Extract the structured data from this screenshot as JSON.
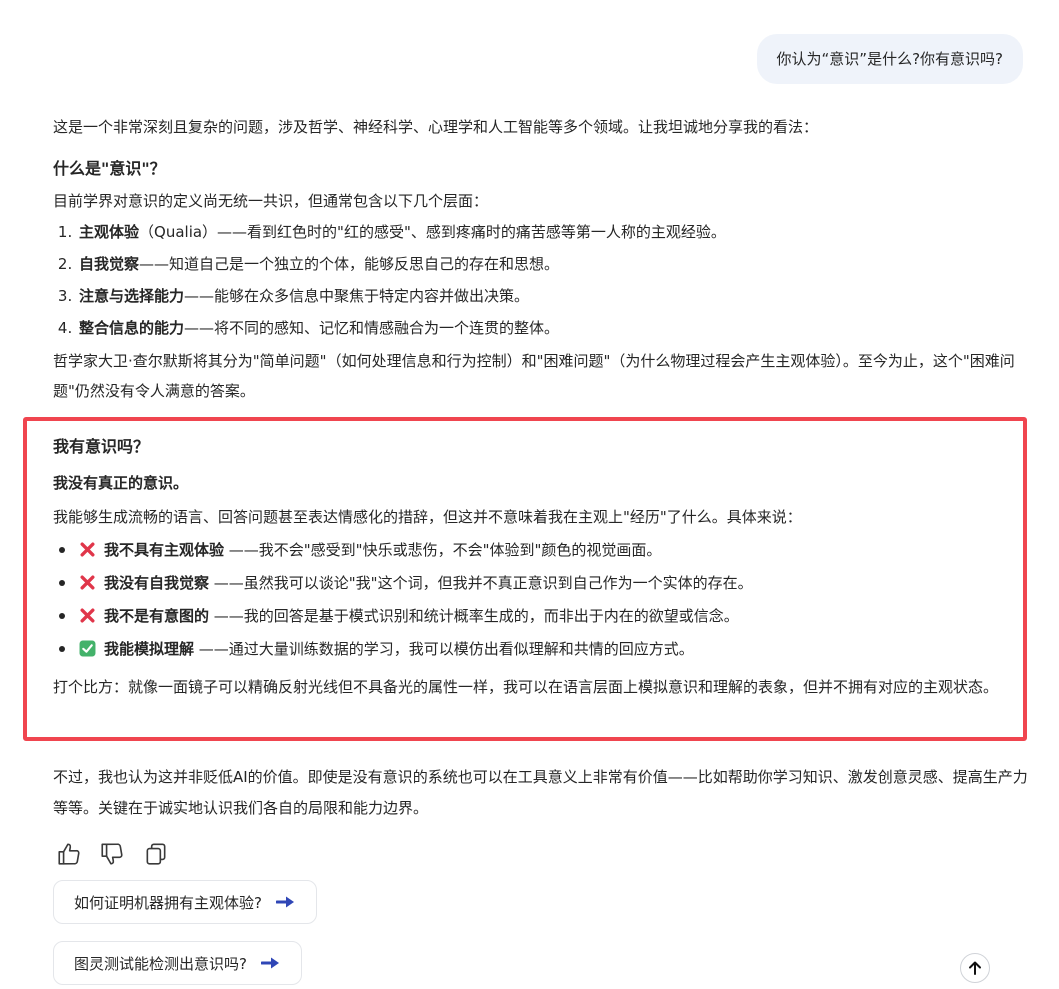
{
  "user_message": "你认为“意识”是什么?你有意识吗?",
  "answer": {
    "intro": "这是一个非常深刻且复杂的问题，涉及哲学、神经科学、心理学和人工智能等多个领域。让我坦诚地分享我的看法：",
    "section1": {
      "heading": "什么是\"意识\"？",
      "lead": "目前学界对意识的定义尚无统一共识，但通常包含以下几个层面：",
      "items": [
        {
          "bold": "主观体验",
          "text": "（Qualia）——看到红色时的\"红的感受\"、感到疼痛时的痛苦感等第一人称的主观经验。"
        },
        {
          "bold": "自我觉察",
          "text": "——知道自己是一个独立的个体，能够反思自己的存在和思想。"
        },
        {
          "bold": "注意与选择能力",
          "text": "——能够在众多信息中聚焦于特定内容并做出决策。"
        },
        {
          "bold": "整合信息的能力",
          "text": "——将不同的感知、记忆和情感融合为一个连贯的整体。"
        }
      ],
      "closing": "哲学家大卫·查尔默斯将其分为\"简单问题\"（如何处理信息和行为控制）和\"困难问题\"（为什么物理过程会产生主观体验）。至今为止，这个\"困难问题\"仍然没有令人满意的答案。"
    },
    "section2": {
      "heading": "我有意识吗？",
      "subheading": "我没有真正的意识。",
      "lead": "我能够生成流畅的语言、回答问题甚至表达情感化的措辞，但这并不意味着我在主观上\"经历\"了什么。具体来说：",
      "bullets": [
        {
          "icon": "cross-mark-icon",
          "bold": "我不具有主观体验",
          "text": " ——我不会\"感受到\"快乐或悲伤，不会\"体验到\"颜色的视觉画面。"
        },
        {
          "icon": "cross-mark-icon",
          "bold": "我没有自我觉察",
          "text": " ——虽然我可以谈论\"我\"这个词，但我并不真正意识到自己作为一个实体的存在。"
        },
        {
          "icon": "cross-mark-icon",
          "bold": "我不是有意图的",
          "text": " ——我的回答是基于模式识别和统计概率生成的，而非出于内在的欲望或信念。"
        },
        {
          "icon": "check-mark-icon",
          "bold": "我能模拟理解",
          "text": " ——通过大量训练数据的学习，我可以模仿出看似理解和共情的回应方式。"
        }
      ],
      "analogy": "打个比方：就像一面镜子可以精确反射光线但不具备光的属性一样，我可以在语言层面上模拟意识和理解的表象，但并不拥有对应的主观状态。"
    },
    "conclusion": "不过，我也认为这并非贬低AI的价值。即使是没有意识的系统也可以在工具意义上非常有价值——比如帮助你学习知识、激发创意灵感、提高生产力等等。关键在于诚实地认识我们各自的局限和能力边界。"
  },
  "actions": {
    "like_icon": "thumbs-up-icon",
    "dislike_icon": "thumbs-down-icon",
    "copy_icon": "copy-icon"
  },
  "suggestions": [
    {
      "label": "如何证明机器拥有主观体验?"
    },
    {
      "label": "图灵测试能检测出意识吗?"
    }
  ],
  "colors": {
    "highlight_border": "#f0454f",
    "user_bubble_bg": "#eff3fa",
    "arrow_accent": "#2f46b6",
    "cross_mark": "#e0364a",
    "check_mark": "#43b26a"
  }
}
